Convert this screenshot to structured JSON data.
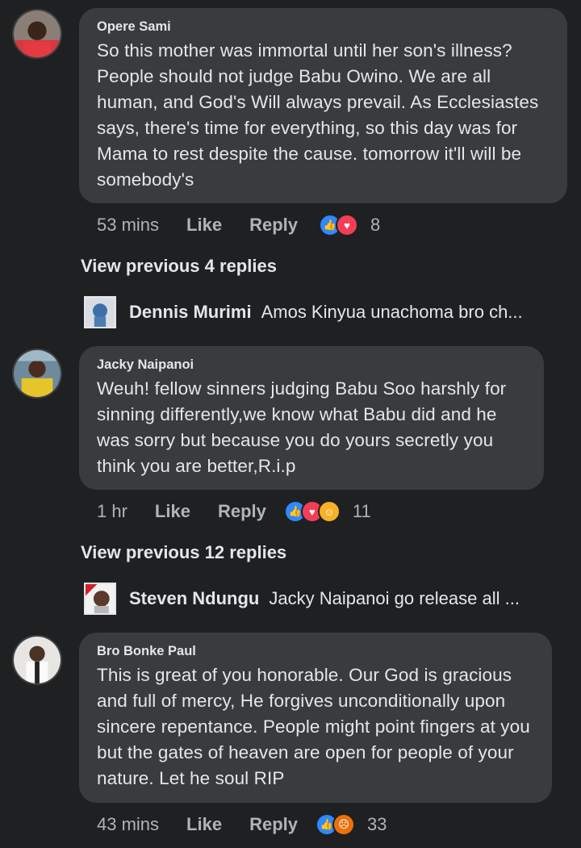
{
  "comments": [
    {
      "name": "Opere Sami",
      "text": "So this mother was immortal until her son's illness? People should not judge Babu Owino. We are all human, and God's Will always prevail. As Ecclesiastes says, there's time for everything, so this day was for Mama to rest despite the cause. tomorrow it'll will be somebody's",
      "time": "53 mins",
      "like": "Like",
      "reply": "Reply",
      "reactions": [
        "like-icon",
        "love-icon"
      ],
      "reaction_count": "8",
      "view_previous": "View previous 4 replies",
      "latest_reply": {
        "name": "Dennis Murimi",
        "text": "Amos Kinyua unachoma bro ch..."
      }
    },
    {
      "name": "Jacky Naipanoi",
      "text": "Weuh! fellow sinners judging Babu Soo harshly for sinning differently,we know what Babu did and he was sorry but because you do yours secretly you think you are better,R.i.p",
      "time": "1 hr",
      "like": "Like",
      "reply": "Reply",
      "reactions": [
        "like-icon",
        "love-icon",
        "haha-icon"
      ],
      "reaction_count": "11",
      "view_previous": "View previous 12 replies",
      "latest_reply": {
        "name": "Steven Ndungu",
        "text": "Jacky Naipanoi go release all ..."
      }
    },
    {
      "name": "Bro Bonke Paul",
      "text": "This is great of you honorable. Our God is gracious and full of mercy, He forgives unconditionally upon sincere repentance. People might point fingers at you but the gates of heaven are open for people of your nature. Let he soul RIP",
      "time": "43 mins",
      "like": "Like",
      "reply": "Reply",
      "reactions": [
        "like-icon",
        "angry-icon"
      ],
      "reaction_count": "33"
    }
  ],
  "colors": {
    "background": "#1f2021",
    "bubble": "#3a3b3c",
    "text": "#e4e6eb",
    "muted": "#b0b3b8",
    "like": "#2e89ff",
    "love": "#f33e58"
  }
}
